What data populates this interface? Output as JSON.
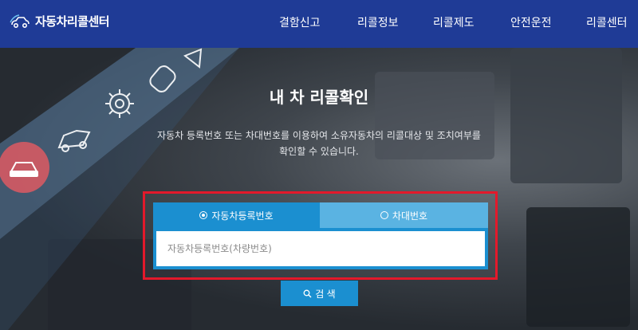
{
  "header": {
    "logo_text": "자동차리콜센터",
    "nav": [
      "결함신고",
      "리콜정보",
      "리콜제도",
      "안전운전",
      "리콜센터"
    ]
  },
  "hero": {
    "title": "내 차 리콜확인",
    "desc_line1": "자동차 등록번호 또는 차대번호를 이용하여 소유자동차의 리콜대상 및 조치여부를",
    "desc_line2": "확인할 수 있습니다."
  },
  "search": {
    "tab_registration": "자동차등록번호",
    "tab_vin": "차대번호",
    "placeholder": "자동차등록번호(차량번호)",
    "button_label": "검 색"
  },
  "colors": {
    "header_bg": "#1f3b96",
    "tab_active": "#1b8fd0",
    "tab_inactive": "#5ab3e2",
    "highlight_border": "#e3192b"
  }
}
